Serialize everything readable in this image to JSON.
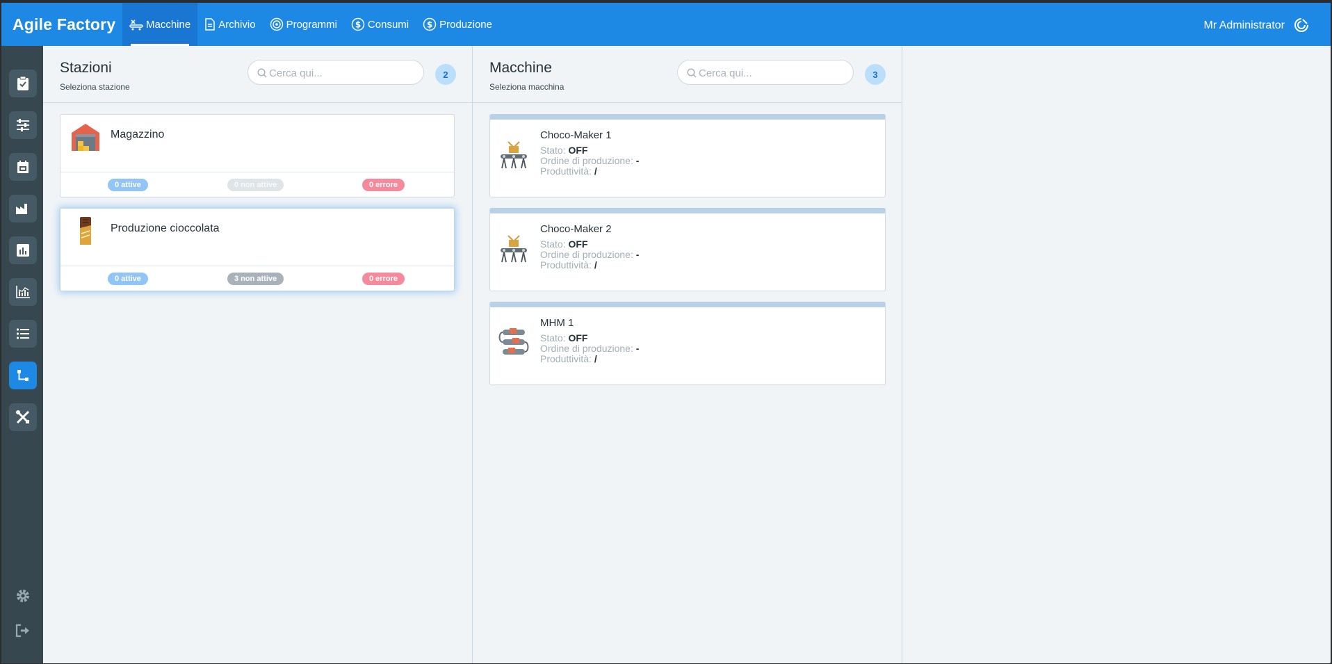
{
  "app": {
    "title": "Agile Factory"
  },
  "nav": [
    {
      "label": "Macchine",
      "icon": "machine-icon"
    },
    {
      "label": "Archivio",
      "icon": "archive-icon"
    },
    {
      "label": "Programmi",
      "icon": "target-icon"
    },
    {
      "label": "Consumi",
      "icon": "dollar-circle-icon"
    },
    {
      "label": "Produzione",
      "icon": "dollar-circle-icon"
    }
  ],
  "user": {
    "name": "Mr Administrator"
  },
  "sidebar": [
    {
      "icon": "clipboard-check-icon"
    },
    {
      "icon": "sliders-icon"
    },
    {
      "icon": "calendar-icon"
    },
    {
      "icon": "factory-icon"
    },
    {
      "icon": "bar-chart-icon"
    },
    {
      "icon": "analytics-icon"
    },
    {
      "icon": "list-icon"
    },
    {
      "icon": "flow-icon",
      "active": true
    },
    {
      "icon": "tools-icon"
    }
  ],
  "stations": {
    "title": "Stazioni",
    "subtitle": "Seleziona stazione",
    "search_placeholder": "Cerca qui...",
    "count": "2",
    "items": [
      {
        "name": "Magazzino",
        "active": "0 attive",
        "inactive": "0 non attive",
        "error": "0 errore"
      },
      {
        "name": "Produzione cioccolata",
        "active": "0 attive",
        "inactive": "3 non attive",
        "error": "0 errore"
      }
    ]
  },
  "machines": {
    "title": "Macchine",
    "subtitle": "Seleziona macchina",
    "search_placeholder": "Cerca qui...",
    "count": "3",
    "labels": {
      "stato": "Stato:",
      "ordine": "Ordine di produzione:",
      "produttivita": "Produttività:"
    },
    "items": [
      {
        "name": "Choco-Maker 1",
        "stato": "OFF",
        "ordine": "-",
        "produttivita": "/"
      },
      {
        "name": "Choco-Maker 2",
        "stato": "OFF",
        "ordine": "-",
        "produttivita": "/"
      },
      {
        "name": "MHM 1",
        "stato": "OFF",
        "ordine": "-",
        "produttivita": "/"
      }
    ]
  },
  "colors": {
    "primary": "#1e88e5",
    "sidebar": "#37474f",
    "background": "#f0f4f7"
  }
}
